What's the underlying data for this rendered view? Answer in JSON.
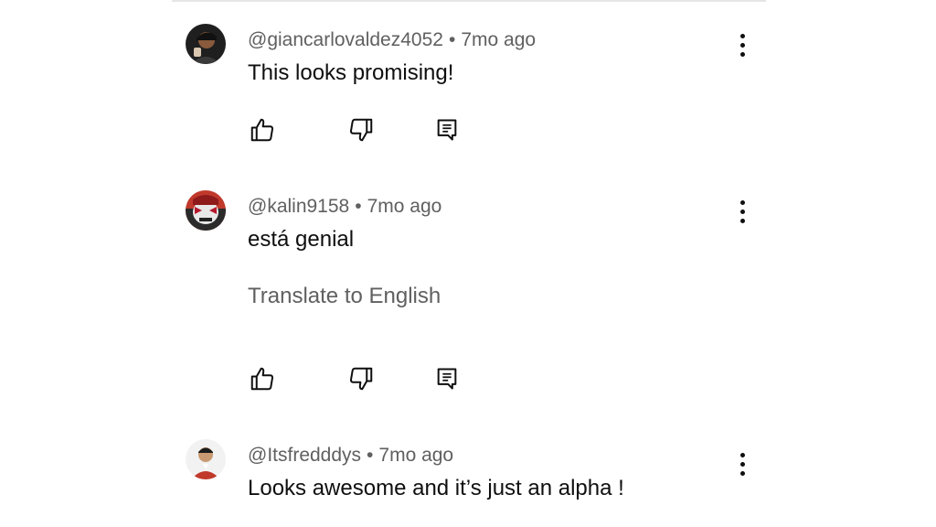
{
  "comments": [
    {
      "handle": "@giancarlovaldez4052",
      "separator": "•",
      "time": "7mo ago",
      "text": "This looks promising!",
      "avatar_icon": "user-avatar-icon"
    },
    {
      "handle": "@kalin9158",
      "separator": "•",
      "time": "7mo ago",
      "text": "está genial",
      "translate_label": "Translate to English",
      "avatar_icon": "masked-character-avatar-icon"
    },
    {
      "handle": "@Itsfredddys",
      "separator": "•",
      "time": "7mo ago",
      "text": "Looks awesome and it’s just an alpha !",
      "avatar_icon": "user-avatar-icon"
    }
  ],
  "icons": {
    "like": "thumbs-up-icon",
    "dislike": "thumbs-down-icon",
    "reply": "reply-icon",
    "menu": "more-vertical-icon"
  }
}
